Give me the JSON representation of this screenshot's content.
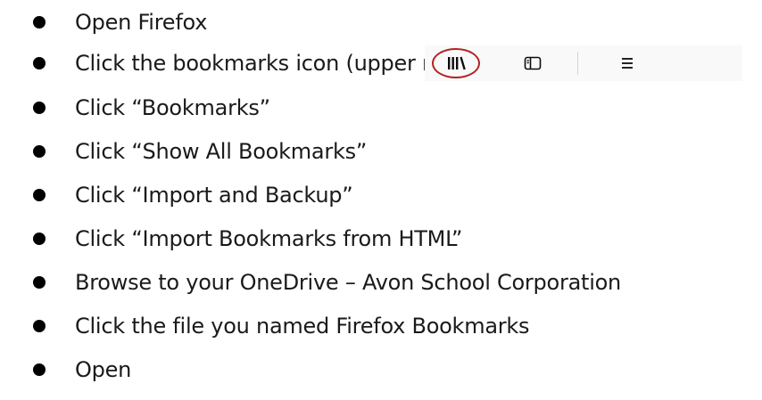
{
  "steps": [
    {
      "text": "Open Firefox"
    },
    {
      "text": "Click the bookmarks icon (upper right)"
    },
    {
      "text": "Click “Bookmarks”"
    },
    {
      "text": "Click “Show All Bookmarks”"
    },
    {
      "text": "Click “Import and Backup”"
    },
    {
      "text": "Click “Import Bookmarks from HTML”"
    },
    {
      "text": "Browse to your OneDrive – Avon School Corporation"
    },
    {
      "text": "Click the file you named Firefox Bookmarks"
    },
    {
      "text": "Open"
    }
  ],
  "toolbar": {
    "icons": [
      "library-icon",
      "sidebar-icon",
      "menu-icon"
    ],
    "highlight_color": "#b22222"
  }
}
